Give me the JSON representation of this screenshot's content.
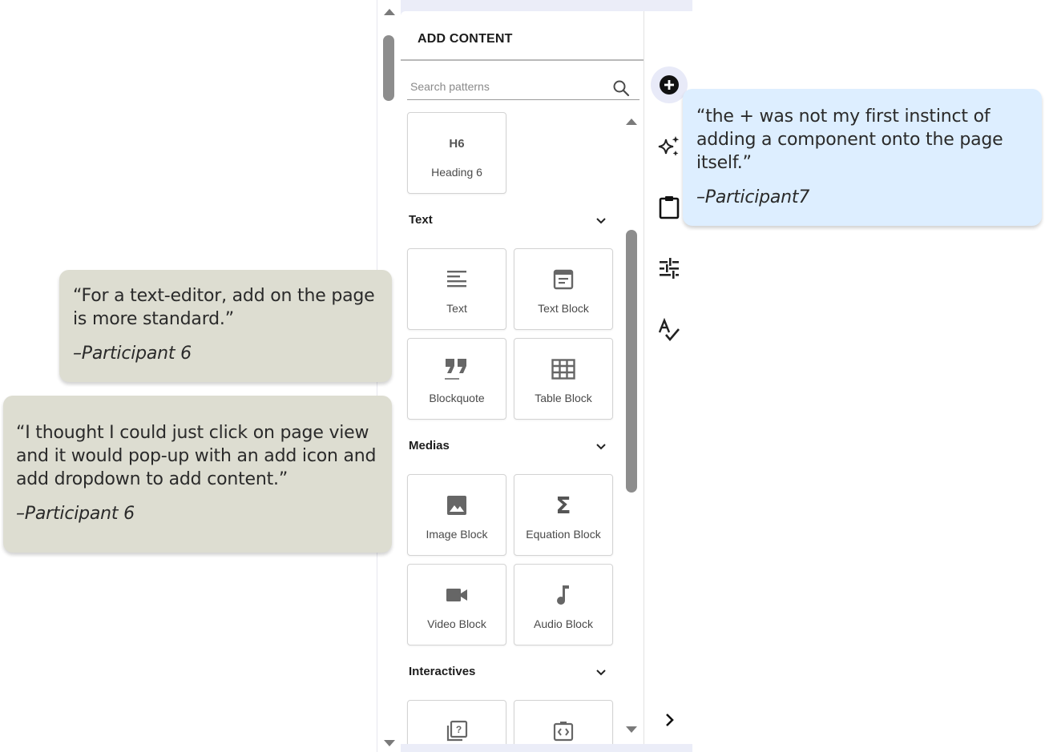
{
  "panel": {
    "title": "ADD CONTENT",
    "search_placeholder": "Search patterns"
  },
  "tiles": {
    "heading6": "Heading 6",
    "heading6_glyph": "H6",
    "text": "Text",
    "text_block": "Text Block",
    "blockquote": "Blockquote",
    "table_block": "Table Block",
    "image_block": "Image Block",
    "equation_block": "Equation Block",
    "video_block": "Video Block",
    "audio_block": "Audio Block"
  },
  "sections": {
    "text": "Text",
    "medias": "Medias",
    "interactives": "Interactives"
  },
  "rail": {
    "icons": [
      "add-icon",
      "sparkle-icon",
      "clipboard-icon",
      "tune-icon",
      "spellcheck-icon",
      "chevron-right-icon"
    ]
  },
  "quotes": {
    "q1_text": "“the + was not my first instinct of adding a component onto the page itself.”",
    "q1_attr": "–Participant7",
    "q2_text": "“For a text-editor, add on the page is more standard.”",
    "q2_attr": "–Participant 6",
    "q3_text": "“I thought I could just click on page view and it would pop-up with an add icon and add dropdown to add content.”",
    "q3_attr": "–Participant 6"
  },
  "colors": {
    "quote_gray": "#ddddd1",
    "quote_blue": "#ddeeff",
    "panel_bg": "#ebedf8"
  }
}
